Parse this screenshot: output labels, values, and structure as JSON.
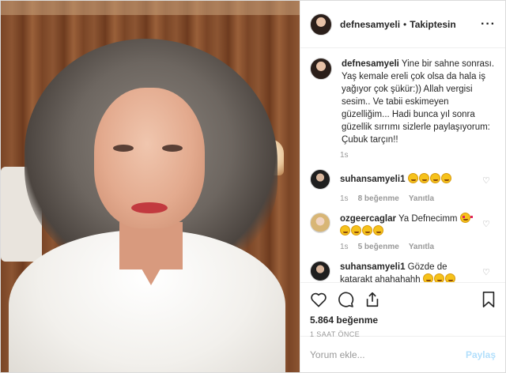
{
  "post": {
    "author": "defnesamyeli",
    "separator": "•",
    "follow_status": "Takiptesin",
    "caption": "Yine bir sahne sonrası. Yaş kemale ereli çok olsa da hala iş yağıyor çok şükür:)) Allah vergisi sesim.. Ve tabii eskimeyen güzelliğim... Hadi bunca yıl sonra güzellik sırrımı sizlerle paylaşıyorum: Çubuk tarçın!!",
    "caption_time": "1s",
    "likes": "5.864 beğenme",
    "posted": "1 SAAT ÖNCE",
    "photo_alt": "Elderly woman with curly grey hair wearing a white robe"
  },
  "comments": [
    {
      "user": "suhansamyeli1",
      "text": "",
      "emoji_count": 4,
      "emoji": "laughing",
      "time": "1s",
      "likes": "8 beğenme",
      "reply": "Yanıtla"
    },
    {
      "user": "ozgeercaglar",
      "text": "Ya Defnecimm",
      "emoji_count": 5,
      "emoji": "heart-eyes",
      "time": "1s",
      "likes": "5 beğenme",
      "reply": "Yanıtla"
    },
    {
      "user": "suhansamyeli1",
      "text": "Gözde de katarakt ahahahahh",
      "emoji_count": 3,
      "emoji": "laughing",
      "time": "",
      "likes": "",
      "reply": ""
    }
  ],
  "add_comment": {
    "placeholder": "Yorum ekle...",
    "post_label": "Paylaş"
  },
  "icons": [
    "heart-icon",
    "comment-icon",
    "share-icon",
    "bookmark-icon",
    "more-icon"
  ]
}
